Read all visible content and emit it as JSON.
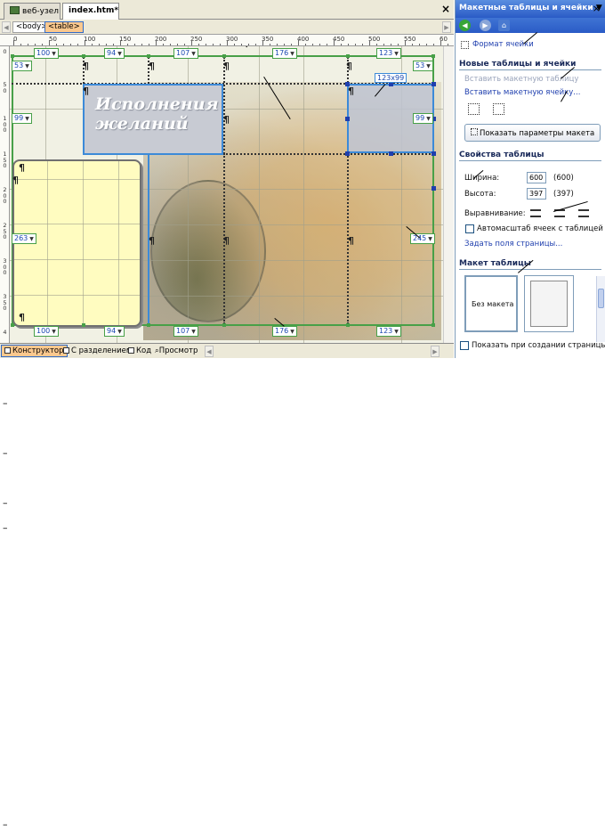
{
  "editor": {
    "tabs": [
      {
        "label": "веб-узел"
      },
      {
        "label": "index.htm*"
      }
    ],
    "close_symbol": "×",
    "tags": [
      "<body>",
      "<table>"
    ],
    "ruler_labels": [
      "0",
      "50",
      "100",
      "150",
      "200",
      "250",
      "300",
      "350",
      "400",
      "450",
      "500",
      "550",
      "60"
    ],
    "vruler_labels": [
      "0",
      "5\n0",
      "1\n0\n0",
      "1\n5\n0",
      "2\n0\n0",
      "2\n5\n0",
      "3\n0\n0",
      "3\n5\n0",
      "4"
    ],
    "canvas": {
      "title_line1": "Исполнения",
      "title_line2": "желаний",
      "pilcrow": "¶",
      "col_widths_top": [
        "100",
        "94",
        "107",
        "176",
        "123"
      ],
      "col_widths_bottom": [
        "100",
        "94",
        "107",
        "176",
        "123"
      ],
      "row_heights_left": [
        "53",
        "99",
        "263"
      ],
      "row_heights_right": [
        "53",
        "99",
        "245"
      ],
      "selected_size": "123x99"
    },
    "views": [
      "Конструктор",
      "С разделением",
      "Код",
      "Просмотр"
    ]
  },
  "pane": {
    "title": "Макетные таблицы и ячейки",
    "close_symbol": "×",
    "cell_format_link": "Формат ячейки",
    "section_new": "Новые таблицы и ячейки",
    "insert_table": "Вставить макетную таблицу",
    "insert_cell": "Вставить макетную ячейку...",
    "show_params": "Показать параметры макета",
    "section_props": "Свойства таблицы",
    "width_label": "Ширина:",
    "width_value": "600",
    "width_actual": "(600)",
    "height_label": "Высота:",
    "height_value": "397",
    "height_actual": "(397)",
    "align_label": "Выравнивание:",
    "autoscale_label": "Автомасштаб ячеек с таблицей",
    "page_margins_link": "Задать поля страницы...",
    "section_layout": "Макет таблицы",
    "no_layout": "Без макета",
    "show_on_create": "Показать при создании страницы"
  },
  "below": {
    "dash": "–"
  },
  "colors": {
    "selection_blue": "#3c8ad8",
    "layout_green": "#48a048",
    "pane_header": "#2a5bc6",
    "yellow_cell": "#fffcc0"
  },
  "icons": [
    "website-icon",
    "back-arrow-icon",
    "forward-arrow-icon",
    "home-icon",
    "cell-format-icon",
    "draw-table-icon",
    "draw-cell-icon",
    "align-left-icon",
    "align-center-icon",
    "align-right-icon",
    "checkbox-icon"
  ]
}
